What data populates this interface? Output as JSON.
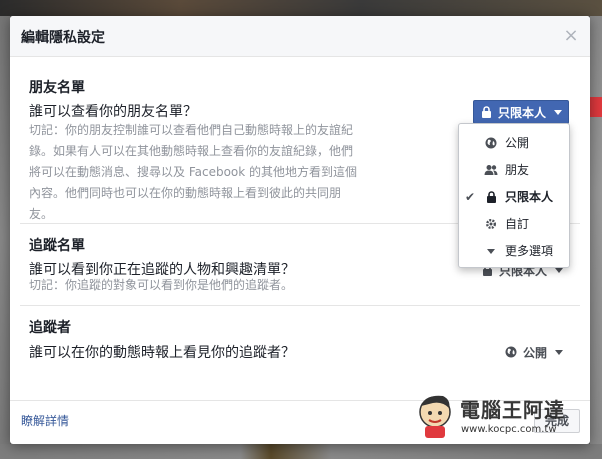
{
  "modal": {
    "title": "編輯隱私設定",
    "close_glyph": "×"
  },
  "friends_list": {
    "section_title": "朋友名單",
    "question": "誰可以查看你的朋友名單？",
    "hint_lines": [
      "切記：你的朋友控制誰可以查看他們自己動態時報上的友誼紀",
      "錄。如果有人可以在其他動態時報上查看你的友誼紀錄，他們",
      "將可以在動態消息、搜尋以及 Facebook 的其他地方看到這個",
      "內容。他們同時也可以在你的動態時報上看到彼此的共同朋",
      "友。"
    ],
    "selected_value": "只限本人",
    "icon": "lock-icon"
  },
  "following_list": {
    "section_title": "追蹤名單",
    "question": "誰可以看到你正在追蹤的人物和興趣清單？",
    "hint": "切記：你追蹤的對象可以看到你是他們的追蹤者。",
    "selected_value": "只限本人"
  },
  "followers": {
    "section_title": "追蹤者",
    "question": "誰可以在你的動態時報上看見你的追蹤者？",
    "selected_value": "公開",
    "icon": "globe-icon"
  },
  "dropdown": {
    "items": [
      {
        "label": "公開",
        "icon": "globe-icon",
        "selected": false
      },
      {
        "label": "朋友",
        "icon": "friends-icon",
        "selected": false
      },
      {
        "label": "只限本人",
        "icon": "lock-icon",
        "selected": true
      },
      {
        "label": "自訂",
        "icon": "gear-icon",
        "selected": false
      },
      {
        "label": "更多選項",
        "icon": "caret-down-icon",
        "selected": false
      }
    ]
  },
  "footer": {
    "learn_more": "瞭解詳情",
    "done_label": "完成"
  },
  "watermark": {
    "text": "電腦王阿達",
    "url": "www.kocpc.com.tw"
  },
  "colors": {
    "accent": "#4267b2",
    "link": "#365899",
    "hint": "#90949c"
  }
}
